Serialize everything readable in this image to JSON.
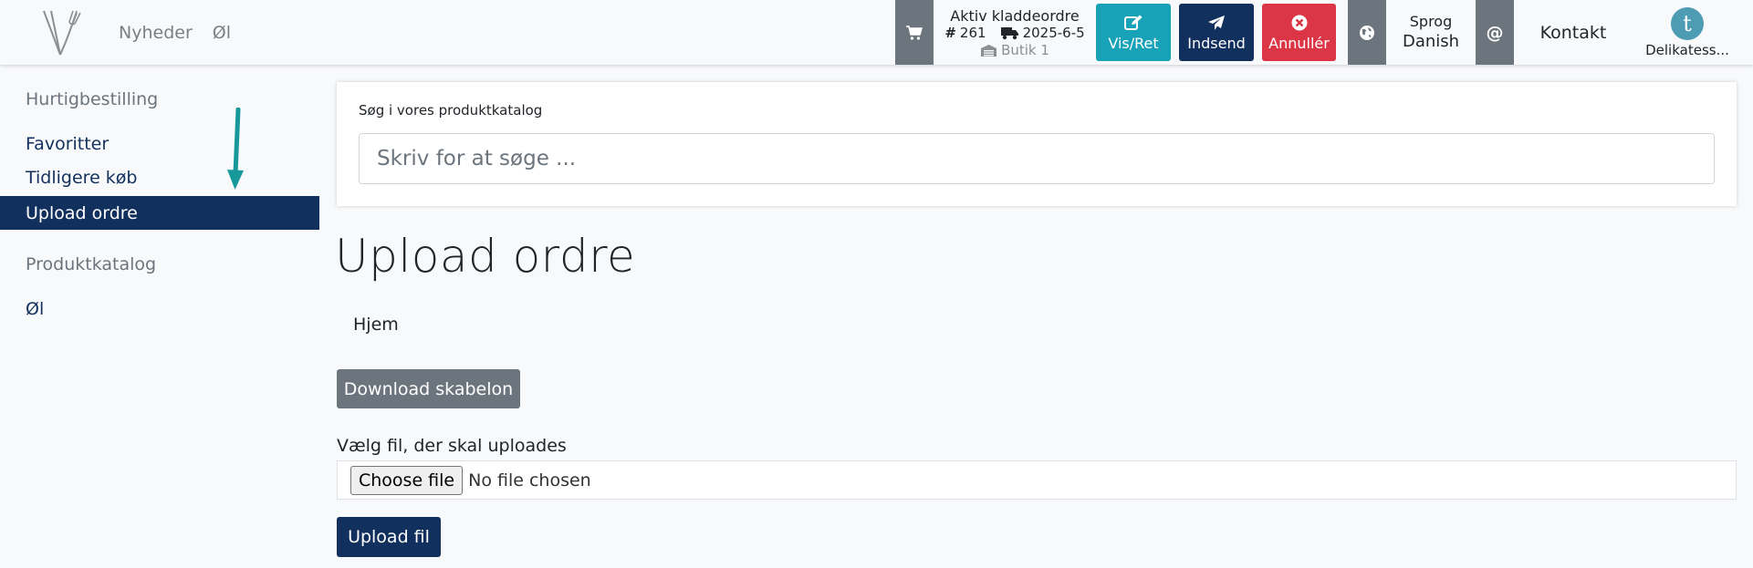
{
  "nav": {
    "links": [
      "Nyheder",
      "Øl"
    ]
  },
  "draft": {
    "title": "Aktiv kladdeordre",
    "number": "261",
    "date": "2025-6-5",
    "store": "Butik 1"
  },
  "actions": {
    "vis_label": "Vis/Ret",
    "indsend_label": "Indsend",
    "annuller_label": "Annullér"
  },
  "language": {
    "label": "Sprog",
    "value": "Danish"
  },
  "contact": {
    "label": "Kontakt"
  },
  "user": {
    "avatar_letter": "t",
    "name": "Delikatess..."
  },
  "sidebar": {
    "quick_heading": "Hurtigbestilling",
    "items": [
      "Favoritter",
      "Tidligere køb",
      "Upload ordre"
    ],
    "catalog_heading": "Produktkatalog",
    "catalog_items": [
      "Øl"
    ]
  },
  "search": {
    "label": "Søg i vores produktkatalog",
    "placeholder": "Skriv for at søge ..."
  },
  "page": {
    "title": "Upload ordre",
    "breadcrumb": "Hjem"
  },
  "upload": {
    "download_label": "Download skabelon",
    "file_label": "Vælg fil, der skal uploades",
    "choose_label": "Choose file",
    "no_file": "No file chosen",
    "upload_label": "Upload fil"
  },
  "colors": {
    "primary": "#12305d",
    "info": "#17a2b8",
    "danger": "#dc3545",
    "secondary": "#6c757d",
    "annotation_arrow": "#17989a"
  }
}
